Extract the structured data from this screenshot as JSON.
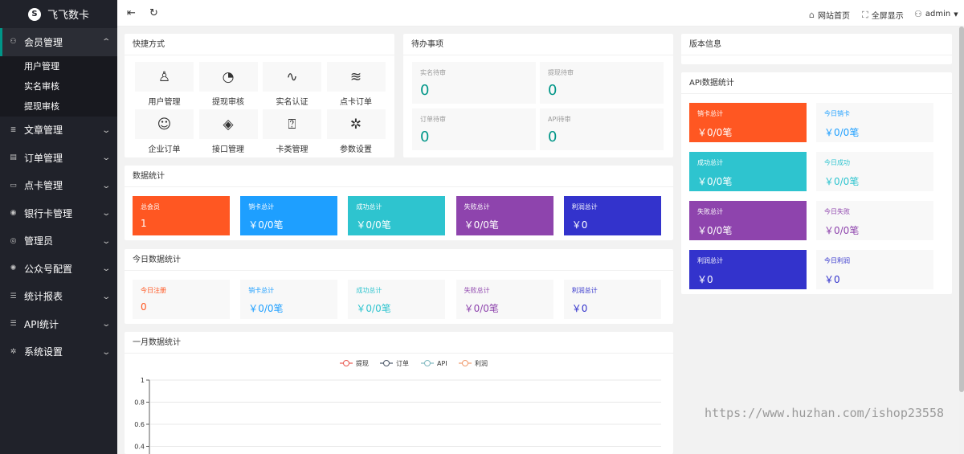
{
  "app": {
    "title": "飞飞数卡",
    "logo_letter": "S"
  },
  "sidebar": {
    "items": [
      {
        "label": "会员管理",
        "icon": "user-icon",
        "glyph": "⚇",
        "expanded": true,
        "children": [
          "用户管理",
          "实名审核",
          "提现审核"
        ]
      },
      {
        "label": "文章管理",
        "icon": "article-icon",
        "glyph": "≣"
      },
      {
        "label": "订单管理",
        "icon": "order-icon",
        "glyph": "▤"
      },
      {
        "label": "点卡管理",
        "icon": "card-icon",
        "glyph": "▭"
      },
      {
        "label": "银行卡管理",
        "icon": "bank-card-icon",
        "glyph": "◉"
      },
      {
        "label": "管理员",
        "icon": "shield-icon",
        "glyph": "◎"
      },
      {
        "label": "公众号配置",
        "icon": "wechat-icon",
        "glyph": "✺"
      },
      {
        "label": "统计报表",
        "icon": "list-icon",
        "glyph": "☰"
      },
      {
        "label": "API统计",
        "icon": "api-list-icon",
        "glyph": "☰"
      },
      {
        "label": "系统设置",
        "icon": "gear-icon",
        "glyph": "✲"
      }
    ]
  },
  "topbar": {
    "links": [
      {
        "label": "网站首页",
        "icon": "home-icon",
        "glyph": "⌂"
      },
      {
        "label": "全屏显示",
        "icon": "fullscreen-icon",
        "glyph": "⛶"
      },
      {
        "label": "admin",
        "icon": "user-icon",
        "glyph": "⚇"
      }
    ]
  },
  "shortcuts": {
    "title": "快捷方式",
    "items": [
      {
        "label": "用户管理",
        "icon": "user-icon",
        "glyph": "♙"
      },
      {
        "label": "提现审核",
        "icon": "dashboard-icon",
        "glyph": "◔"
      },
      {
        "label": "实名认证",
        "icon": "pulse-icon",
        "glyph": "∿"
      },
      {
        "label": "点卡订单",
        "icon": "layers-icon",
        "glyph": "≋"
      },
      {
        "label": "企业订单",
        "icon": "smile-icon",
        "glyph": "☺"
      },
      {
        "label": "接口管理",
        "icon": "compass-icon",
        "glyph": "◈"
      },
      {
        "label": "卡类管理",
        "icon": "question-edit-icon",
        "glyph": "⍰"
      },
      {
        "label": "参数设置",
        "icon": "gear-icon",
        "glyph": "✲"
      }
    ]
  },
  "todo": {
    "title": "待办事项",
    "items": [
      {
        "label": "实名待审",
        "value": "0"
      },
      {
        "label": "提现待审",
        "value": "0"
      },
      {
        "label": "订单待审",
        "value": "0"
      },
      {
        "label": "API待审",
        "value": "0"
      }
    ]
  },
  "version": {
    "title": "版本信息"
  },
  "data_stats": {
    "title": "数据统计",
    "items": [
      {
        "label": "总会员",
        "value": "1",
        "color": "#ff5722"
      },
      {
        "label": "销卡总计",
        "value": "￥0/0笔",
        "color": "#1e9fff"
      },
      {
        "label": "成功总计",
        "value": "￥0/0笔",
        "color": "#2ec4cf"
      },
      {
        "label": "失败总计",
        "value": "￥0/0笔",
        "color": "#8e44ad"
      },
      {
        "label": "利润总计",
        "value": "￥0",
        "color": "#3333cc"
      }
    ]
  },
  "today_stats": {
    "title": "今日数据统计",
    "items": [
      {
        "label": "今日注册",
        "value": "0",
        "color": "#ff5722"
      },
      {
        "label": "销卡总计",
        "value": "￥0/0笔",
        "color": "#1e9fff"
      },
      {
        "label": "成功总计",
        "value": "￥0/0笔",
        "color": "#2ec4cf"
      },
      {
        "label": "失败总计",
        "value": "￥0/0笔",
        "color": "#8e44ad"
      },
      {
        "label": "利润总计",
        "value": "￥0",
        "color": "#3333cc"
      }
    ]
  },
  "api_stats": {
    "title": "API数据统计",
    "rows": [
      {
        "total_label": "销卡总计",
        "total_value": "￥0/0笔",
        "today_label": "今日销卡",
        "today_value": "￥0/0笔",
        "color": "#ff5722",
        "today_color": "#1e9fff"
      },
      {
        "total_label": "成功总计",
        "total_value": "￥0/0笔",
        "today_label": "今日成功",
        "today_value": "￥0/0笔",
        "color": "#2ec4cf",
        "today_color": "#2ec4cf"
      },
      {
        "total_label": "失败总计",
        "total_value": "￥0/0笔",
        "today_label": "今日失败",
        "today_value": "￥0/0笔",
        "color": "#8e44ad",
        "today_color": "#8e44ad"
      },
      {
        "total_label": "利润总计",
        "total_value": "￥0",
        "today_label": "今日利润",
        "today_value": "￥0",
        "color": "#3333cc",
        "today_color": "#3333cc"
      }
    ]
  },
  "chart_data": {
    "type": "line",
    "title": "一月数据统计",
    "series": [
      {
        "name": "提现",
        "color": "#e8584f",
        "values": []
      },
      {
        "name": "订单",
        "color": "#4a5566",
        "values": []
      },
      {
        "name": "API",
        "color": "#7fb8bf",
        "values": []
      },
      {
        "name": "利润",
        "color": "#ef9b6e",
        "values": []
      }
    ],
    "y_ticks": [
      "1",
      "0.8",
      "0.6",
      "0.4"
    ],
    "ylim": [
      0,
      1
    ],
    "grid": true,
    "legend_position": "top-center"
  },
  "watermark": "https://www.huzhan.com/ishop23558"
}
